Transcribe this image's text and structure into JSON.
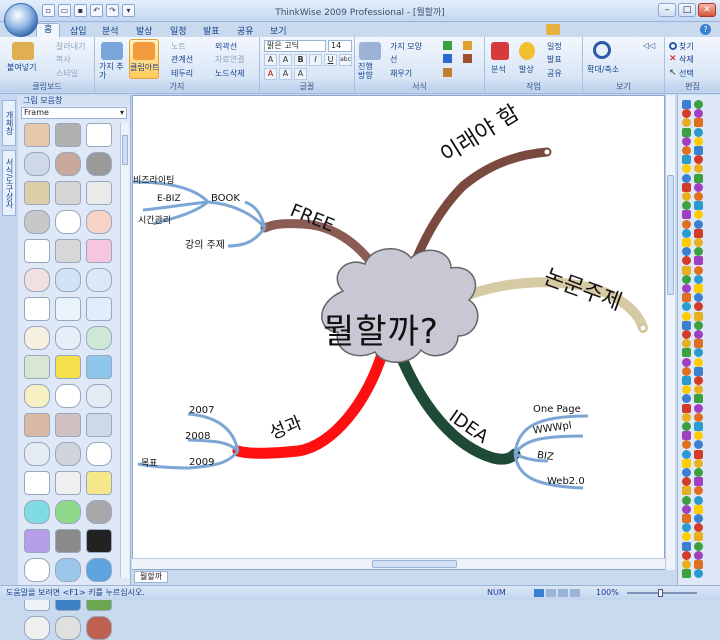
{
  "window": {
    "title": "ThinkWise 2009 Professional - [뭘할까]",
    "controls": [
      "–",
      "□",
      "✕"
    ]
  },
  "quick_access": [
    "new",
    "open",
    "save",
    "undo",
    "redo",
    "more"
  ],
  "tabs": [
    {
      "label": "홈",
      "active": true
    },
    {
      "label": "삽입"
    },
    {
      "label": "분석"
    },
    {
      "label": "발상"
    },
    {
      "label": "일정"
    },
    {
      "label": "발표"
    },
    {
      "label": "공유"
    },
    {
      "label": "보기"
    }
  ],
  "ribbon": {
    "clipboard": {
      "label": "클립보드",
      "paste": "붙여넣기",
      "cut": "잘라내기",
      "copy": "복사",
      "style": "스타일"
    },
    "branch": {
      "label": "가지",
      "add_branch": "가지 추가",
      "clipart": "클립아트",
      "note": "노트",
      "relation": "관계선",
      "border": "테두리",
      "outline": "외곽선",
      "data_link": "자료연결",
      "delete_node": "노드삭제"
    },
    "font": {
      "label": "글꼴",
      "font_name": "맑은 고딕",
      "font_size": "14",
      "format_buttons": [
        "A",
        "A",
        "B",
        "I",
        "U",
        "abc",
        "A",
        "A",
        "A"
      ]
    },
    "format": {
      "label": "서식",
      "progress_direction": "진행 방향",
      "branch_shape": "가지 모양",
      "line": "선",
      "fill": "채우기"
    },
    "task": {
      "label": "작업",
      "analysis": "분석",
      "idea": "발상",
      "schedule": "일정",
      "present": "발표",
      "share": "공유"
    },
    "view": {
      "label": "보기",
      "zoom": "확대/축소"
    },
    "edit": {
      "label": "편집",
      "find": "찾기",
      "delete": "삭제",
      "select": "선택"
    }
  },
  "left_panel": {
    "vertical_tabs": [
      "개체창",
      "서식/도구상자"
    ],
    "gallery_title": "그림 모음창",
    "gallery_select": "Frame",
    "clip_colors": [
      [
        "#e6c9a8",
        "#b0b0b0",
        "#ffffff"
      ],
      [
        "#cfd8e6",
        "#c7a89a",
        "#9a9a9a"
      ],
      [
        "#ddd0a8",
        "#d6d6d6",
        "#eaeaea"
      ],
      [
        "#c8c8c8",
        "#ffffff",
        "#f7d3c8"
      ],
      [
        "#ffffff",
        "#d7d7d7",
        "#f5c6de"
      ],
      [
        "#f0e0e0",
        "#cfe3f5",
        "#dbe9f7"
      ],
      [
        "#ffffff",
        "#e9f3fb",
        "#e0eefb"
      ],
      [
        "#f5f0e0",
        "#e6eef7",
        "#cfe8d6"
      ],
      [
        "#d8e6d2",
        "#f4e04a",
        "#8ec7ea"
      ],
      [
        "#f6efc2",
        "#ffffff",
        "#e6ecf4"
      ],
      [
        "#d9b8a4",
        "#d0c0c0",
        "#cfd8e6"
      ],
      [
        "#e6ecf4",
        "#cfd3da",
        "#ffffff"
      ],
      [
        "#ffffff",
        "#f0f0f0",
        "#f4e88a"
      ],
      [
        "#7fdbe4",
        "#8ed88a",
        "#a8a8a8"
      ],
      [
        "#b49ee8",
        "#8a8a8a",
        "#222222"
      ],
      [
        "#ffffff",
        "#9cc7ea",
        "#5ea5df"
      ],
      [
        "#eef3f8",
        "#3b7fc4",
        "#6aa84f"
      ],
      [
        "#f0f0f0",
        "#e0e0e0",
        "#c06050"
      ]
    ]
  },
  "mindmap": {
    "central": "뭘할까?",
    "branches": [
      {
        "label": "FREE",
        "color": "#8b5b56",
        "children": [
          "BOOK",
          "강의 주제"
        ],
        "subchildren": [
          "비즈라이팅",
          "E-BIZ",
          "시간관리"
        ]
      },
      {
        "label": "이래야 함",
        "color": "#7a4a3e",
        "children": []
      },
      {
        "label": "논문주제",
        "color": "#d6caa4",
        "children": []
      },
      {
        "label": "성과",
        "color": "#ff1010",
        "children": [
          "2007",
          "2008",
          "2009"
        ],
        "subchildren": [
          "목표"
        ]
      },
      {
        "label": "IDEA",
        "color": "#1f4a35",
        "children": [
          "One Page",
          "WWWpl",
          "BIZ",
          "Web2.0"
        ]
      }
    ]
  },
  "right_panel": {
    "icon_colors": [
      "#3a7fd0",
      "#d23a2a",
      "#e8b020",
      "#3aa040",
      "#a040c0",
      "#e07020",
      "#2a9ad0",
      "#ffcc00"
    ]
  },
  "doc_tab": "뭘할까",
  "status": {
    "help_text": "도움말을 보려면 <F1> 키를 누르십시오.",
    "num": "NUM",
    "zoom": "100%"
  }
}
